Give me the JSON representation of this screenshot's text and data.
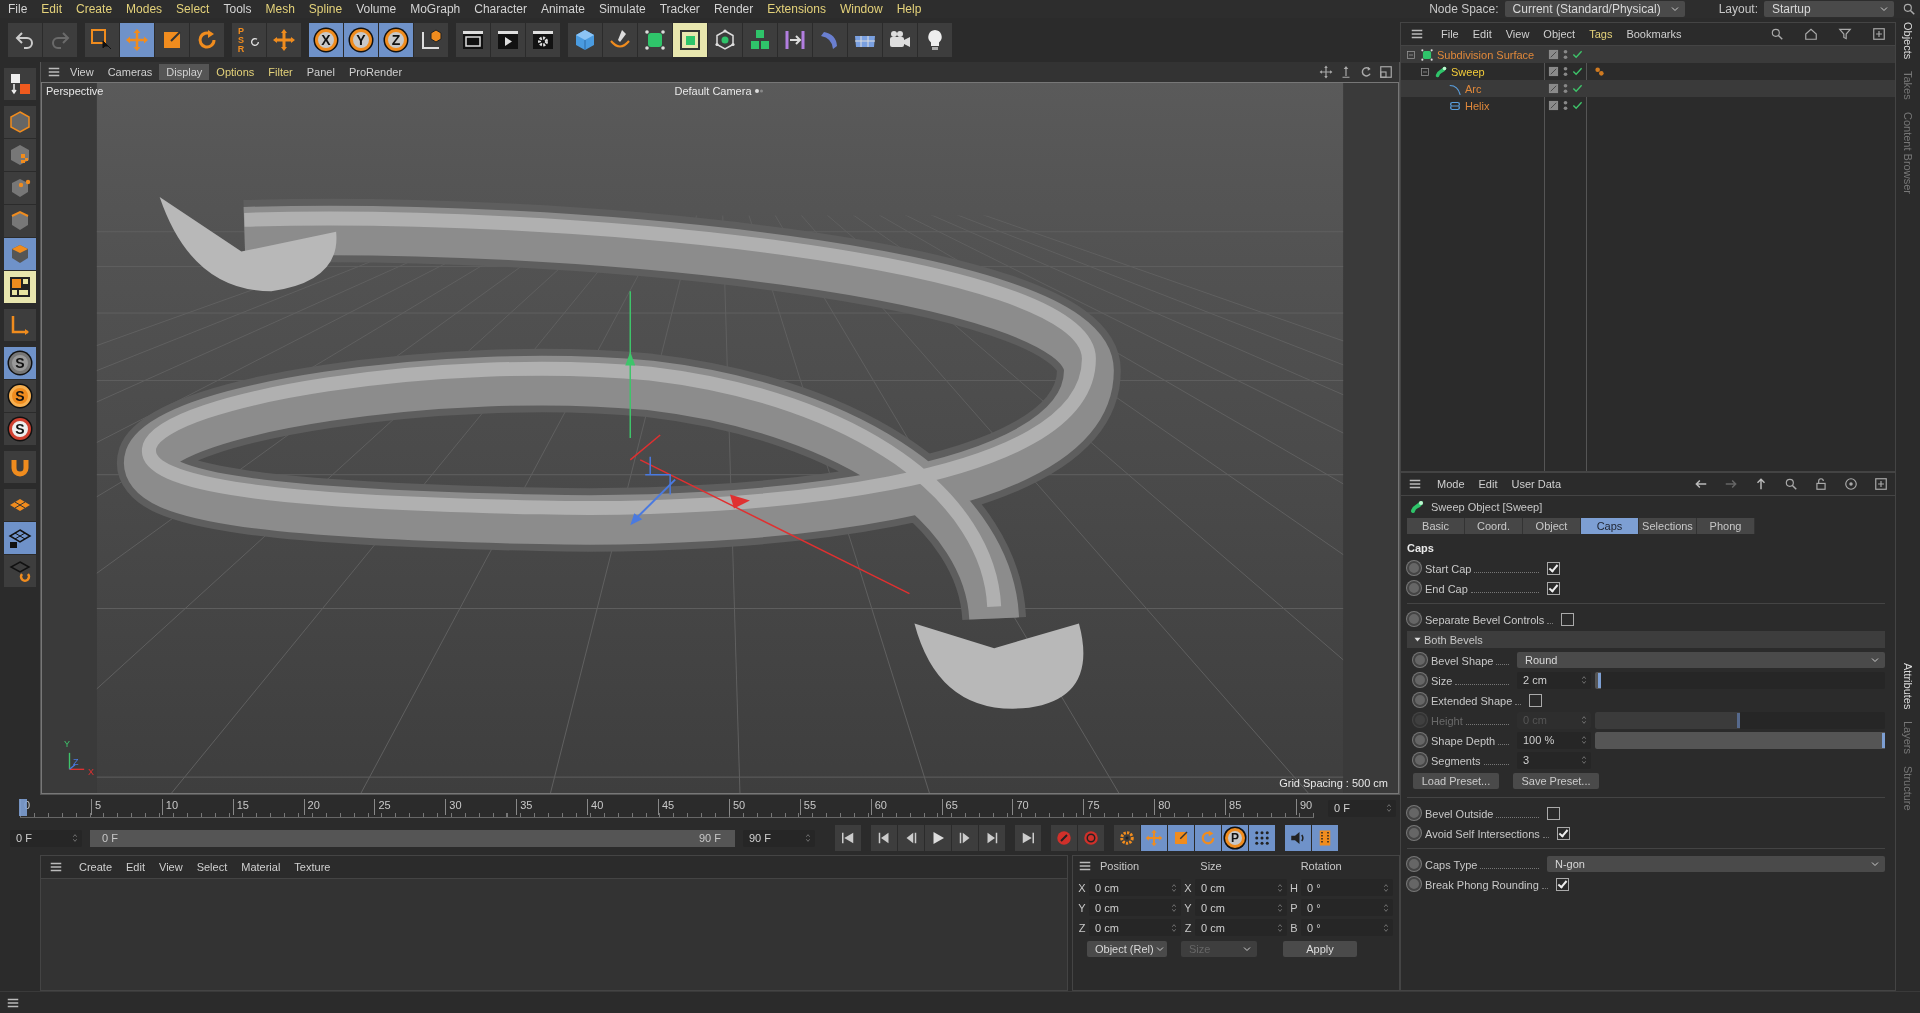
{
  "menu_bar": {
    "items": [
      {
        "label": "File",
        "highlighted": false
      },
      {
        "label": "Edit",
        "highlighted": true
      },
      {
        "label": "Create",
        "highlighted": true
      },
      {
        "label": "Modes",
        "highlighted": true
      },
      {
        "label": "Select",
        "highlighted": true
      },
      {
        "label": "Tools",
        "highlighted": false
      },
      {
        "label": "Mesh",
        "highlighted": true
      },
      {
        "label": "Spline",
        "highlighted": true
      },
      {
        "label": "Volume",
        "highlighted": false
      },
      {
        "label": "MoGraph",
        "highlighted": false
      },
      {
        "label": "Character",
        "highlighted": false
      },
      {
        "label": "Animate",
        "highlighted": false
      },
      {
        "label": "Simulate",
        "highlighted": false
      },
      {
        "label": "Tracker",
        "highlighted": false
      },
      {
        "label": "Render",
        "highlighted": false
      },
      {
        "label": "Extensions",
        "highlighted": true
      },
      {
        "label": "Window",
        "highlighted": true
      },
      {
        "label": "Help",
        "highlighted": true
      }
    ],
    "node_space": {
      "label": "Node Space:",
      "value": "Current (Standard/Physical)"
    },
    "layout": {
      "label": "Layout:",
      "value": "Startup"
    }
  },
  "toolbar_groups": [
    {
      "tools": [
        {
          "kind": "undo",
          "selected": false
        },
        {
          "kind": "redo",
          "selected": false
        }
      ]
    },
    {
      "tools": [
        {
          "kind": "select",
          "selected": false
        },
        {
          "kind": "move",
          "selected": true
        },
        {
          "kind": "scale",
          "selected": false
        },
        {
          "kind": "rotate",
          "selected": false
        }
      ]
    },
    {
      "tools": [
        {
          "kind": "psr",
          "label": "PSR",
          "selected": false
        },
        {
          "kind": "cross",
          "selected": false
        }
      ]
    },
    {
      "tools": [
        {
          "kind": "axis_lock",
          "label": "X",
          "selected": true
        },
        {
          "kind": "axis_lock",
          "label": "Y",
          "selected": true
        },
        {
          "kind": "axis_lock",
          "label": "Z",
          "selected": true
        },
        {
          "kind": "coord",
          "selected": false
        }
      ]
    },
    {
      "tools": [
        {
          "kind": "clap",
          "selected": false
        },
        {
          "kind": "clapplay",
          "selected": false
        },
        {
          "kind": "clapgear",
          "selected": false
        }
      ]
    },
    {
      "tools": [
        {
          "kind": "cube",
          "selected": false
        },
        {
          "kind": "pen",
          "selected": false
        },
        {
          "kind": "subdiv",
          "selected": false
        },
        {
          "kind": "sweepgen",
          "selected": true
        },
        {
          "kind": "cloner",
          "selected": false
        },
        {
          "kind": "cubes",
          "selected": false
        },
        {
          "kind": "symmetry",
          "selected": false
        },
        {
          "kind": "deform",
          "selected": false
        },
        {
          "kind": "floor",
          "selected": false
        },
        {
          "kind": "camera",
          "selected": false
        },
        {
          "kind": "light",
          "selected": false
        }
      ]
    }
  ],
  "left_tool_groups": [
    {
      "tools": [
        {
          "kind": "editable",
          "selected": false
        }
      ]
    },
    {
      "tools": [
        {
          "kind": "model",
          "selected": false
        },
        {
          "kind": "texture",
          "selected": false
        },
        {
          "kind": "point",
          "selected": false
        },
        {
          "kind": "edge",
          "selected": false
        },
        {
          "kind": "polygon",
          "selected": true
        },
        {
          "kind": "uv",
          "selected": true
        }
      ]
    },
    {
      "tools": [
        {
          "kind": "axis",
          "selected": false
        }
      ]
    },
    {
      "tools": [
        {
          "kind": "snap",
          "label": "S",
          "selected": true
        },
        {
          "kind": "snap_orange",
          "label": "S",
          "selected": false
        },
        {
          "kind": "snap_ring",
          "label": "S",
          "selected": false
        }
      ]
    },
    {
      "tools": [
        {
          "kind": "magnet",
          "selected": false
        }
      ]
    },
    {
      "tools": [
        {
          "kind": "plane",
          "selected": false
        },
        {
          "kind": "planelock",
          "selected": true
        },
        {
          "kind": "planerot",
          "selected": false
        }
      ]
    }
  ],
  "viewport": {
    "menu": [
      {
        "label": "View",
        "selected": false,
        "highlighted": false
      },
      {
        "label": "Cameras",
        "selected": false,
        "highlighted": false
      },
      {
        "label": "Display",
        "selected": true,
        "highlighted": false
      },
      {
        "label": "Options",
        "selected": false,
        "highlighted": true
      },
      {
        "label": "Filter",
        "selected": false,
        "highlighted": true
      },
      {
        "label": "Panel",
        "selected": false,
        "highlighted": false
      },
      {
        "label": "ProRender",
        "selected": false,
        "highlighted": false
      }
    ],
    "view_name": "Perspective",
    "camera": "Default Camera",
    "grid_spacing": "Grid Spacing : 500 cm",
    "axis_labels": [
      "Y",
      "Z",
      "X"
    ]
  },
  "timeline": {
    "ticks": [
      "0",
      "5",
      "10",
      "15",
      "20",
      "25",
      "30",
      "35",
      "40",
      "45",
      "50",
      "55",
      "60",
      "65",
      "70",
      "75",
      "80",
      "85",
      "90"
    ],
    "level": 0,
    "current_frame": "0 F",
    "start_field": "0 F",
    "range": {
      "start": "0 F",
      "end": "90 F"
    },
    "end_field": "90 F",
    "control_groups": [
      {
        "tools": [
          {
            "kind": "start",
            "selected": false
          }
        ]
      },
      {
        "tools": [
          {
            "kind": "prevkey",
            "selected": false
          },
          {
            "kind": "prevframe",
            "selected": false
          },
          {
            "kind": "play",
            "selected": false
          },
          {
            "kind": "nextframe",
            "selected": false
          },
          {
            "kind": "nextkey",
            "selected": false
          }
        ]
      },
      {
        "tools": [
          {
            "kind": "end",
            "selected": false
          }
        ]
      },
      {
        "tools": [
          {
            "kind": "record",
            "selected": false
          },
          {
            "kind": "autokey",
            "selected": false
          }
        ]
      },
      {
        "tools": [
          {
            "kind": "keygear",
            "selected": false
          },
          {
            "kind": "move",
            "selected": true
          },
          {
            "kind": "scale",
            "selected": true
          },
          {
            "kind": "rotate",
            "selected": true
          },
          {
            "kind": "param",
            "label": "P",
            "selected": true
          },
          {
            "kind": "dots",
            "selected": true
          }
        ]
      },
      {
        "tools": [
          {
            "kind": "sound",
            "selected": true
          },
          {
            "kind": "film",
            "selected": true
          }
        ]
      }
    ]
  },
  "material_manager": {
    "menu": [
      "Create",
      "Edit",
      "View",
      "Select",
      "Material",
      "Texture"
    ]
  },
  "coordinates": {
    "headers": [
      "Position",
      "Size",
      "Rotation"
    ],
    "rows": [
      [
        {
          "axis": "X",
          "value": "0 cm"
        },
        {
          "axis": "X",
          "value": "0 cm"
        },
        {
          "axis": "H",
          "value": "0 °"
        }
      ],
      [
        {
          "axis": "Y",
          "value": "0 cm"
        },
        {
          "axis": "Y",
          "value": "0 cm"
        },
        {
          "axis": "P",
          "value": "0 °"
        }
      ],
      [
        {
          "axis": "Z",
          "value": "0 cm"
        },
        {
          "axis": "Z",
          "value": "0 cm"
        },
        {
          "axis": "B",
          "value": "0 °"
        }
      ]
    ],
    "mode": "Object (Rel)",
    "size_mode": {
      "label": "Size",
      "disabled": true
    },
    "apply": "Apply"
  },
  "object_manager": {
    "menu": [
      {
        "label": "File",
        "highlighted": false
      },
      {
        "label": "Edit",
        "highlighted": false
      },
      {
        "label": "View",
        "highlighted": false
      },
      {
        "label": "Object",
        "highlighted": false
      },
      {
        "label": "Tags",
        "highlighted": true
      },
      {
        "label": "Bookmarks",
        "highlighted": false
      }
    ],
    "objects": [
      {
        "name": "Subdivision Surface",
        "kind": "subdiv",
        "selected": false,
        "enabled": true,
        "children": [
          {
            "name": "Sweep",
            "kind": "sweep",
            "selected": true,
            "enabled": true,
            "tags": [
              {
                "kind": "phong"
              }
            ],
            "children": [
              {
                "name": "Arc",
                "kind": "arc",
                "selected": false,
                "enabled": true
              },
              {
                "name": "Helix",
                "kind": "helix",
                "selected": false,
                "enabled": true
              }
            ]
          }
        ]
      }
    ]
  },
  "side_tabs_top": [
    {
      "label": "Objects",
      "selected": true
    },
    {
      "label": "Takes",
      "selected": false
    },
    {
      "label": "Content Browser",
      "selected": false
    }
  ],
  "side_tabs_bottom": [
    {
      "label": "Attributes",
      "selected": true
    },
    {
      "label": "Layers",
      "selected": false
    },
    {
      "label": "Structure",
      "selected": false
    }
  ],
  "attributes": {
    "menu": [
      "Mode",
      "Edit",
      "User Data"
    ],
    "title": "Sweep Object [Sweep]",
    "tabs": [
      {
        "label": "Basic",
        "selected": false
      },
      {
        "label": "Coord.",
        "selected": false
      },
      {
        "label": "Object",
        "selected": false
      },
      {
        "label": "Caps",
        "selected": true
      },
      {
        "label": "Selections",
        "selected": false
      },
      {
        "label": "Phong",
        "selected": false
      }
    ],
    "section": "Caps",
    "params": [
      {
        "kind": "checkbox",
        "label": "Start Cap",
        "checked": true
      },
      {
        "kind": "checkbox",
        "label": "End Cap",
        "checked": true
      },
      {
        "kind": "divider"
      },
      {
        "kind": "checkbox",
        "label": "Separate Bevel Controls",
        "checked": false
      },
      {
        "kind": "group",
        "label": "Both Bevels",
        "expanded": true,
        "children": [
          {
            "kind": "dropdown",
            "label": "Bevel Shape",
            "value": "Round"
          },
          {
            "kind": "slider",
            "label": "Size",
            "value": "2 cm",
            "level": 0.02,
            "disabled": false
          },
          {
            "kind": "checkbox",
            "label": "Extended Shape",
            "checked": false
          },
          {
            "kind": "slider",
            "label": "Height",
            "value": "0 cm",
            "level": 0.5,
            "disabled": true
          },
          {
            "kind": "slider",
            "label": "Shape Depth",
            "value": "100 %",
            "level": 1,
            "disabled": false
          },
          {
            "kind": "number",
            "label": "Segments",
            "value": "3"
          },
          {
            "kind": "buttons",
            "labels": [
              "Load Preset...",
              "Save Preset..."
            ]
          }
        ]
      },
      {
        "kind": "divider"
      },
      {
        "kind": "checkbox",
        "label": "Bevel Outside",
        "checked": false
      },
      {
        "kind": "checkbox",
        "label": "Avoid Self Intersections",
        "checked": true
      },
      {
        "kind": "divider"
      },
      {
        "kind": "dropdown",
        "label": "Caps Type",
        "value": "N-gon"
      },
      {
        "kind": "checkbox",
        "label": "Break Phong Rounding",
        "checked": true
      }
    ]
  }
}
